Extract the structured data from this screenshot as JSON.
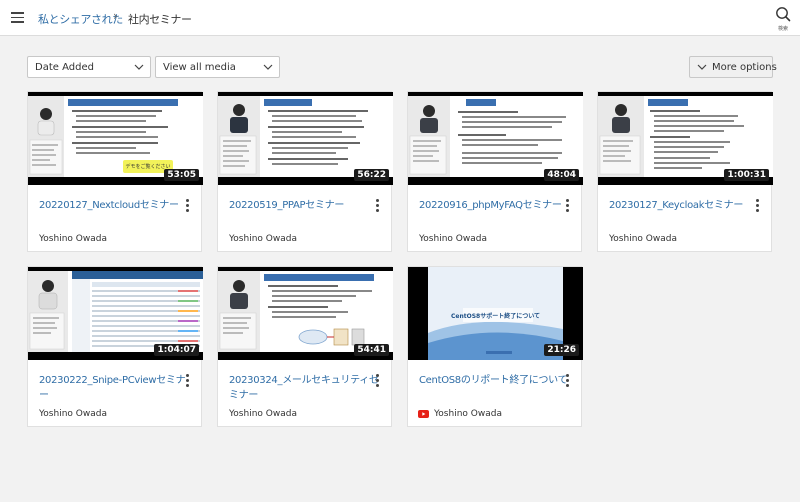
{
  "header": {
    "breadcrumb_parent": "私とシェアされた",
    "breadcrumb_separator": "›",
    "breadcrumb_current": "社内セミナー",
    "search_label": "検索"
  },
  "toolbar": {
    "sort_select": "Date Added",
    "filter_select": "View all media",
    "more_options": "More options"
  },
  "icons": {
    "menu": "hamburger-icon",
    "search": "search-icon",
    "chevron": "chevron-down-icon",
    "more": "kebab-menu-icon",
    "source": "youtube-icon"
  },
  "colors": {
    "link": "#2f6da6",
    "youtube": "#e62117"
  },
  "videos": [
    {
      "title": "20220127_Nextcloudセミナー",
      "duration": "53:05",
      "owner": "Yoshino Owada",
      "thumb_highlight": "デモをご覧ください"
    },
    {
      "title": "20220519_PPAPセミナー",
      "duration": "56:22",
      "owner": "Yoshino Owada"
    },
    {
      "title": "20220916_phpMyFAQセミナー",
      "duration": "48:04",
      "owner": "Yoshino Owada"
    },
    {
      "title": "20230127_Keycloakセミナー",
      "duration": "1:00:31",
      "owner": "Yoshino Owada"
    },
    {
      "title": "20230222_Snipe-PCviewセミナー",
      "duration": "1:04:07",
      "owner": "Yoshino Owada"
    },
    {
      "title": "20230324_メールセキュリティセミナー",
      "duration": "54:41",
      "owner": "Yoshino Owada"
    },
    {
      "title": "CentOS8のリポート終了について",
      "duration": "21:26",
      "owner": "Yoshino Owada",
      "thumb_highlight": "CentOS8サポート終了について"
    }
  ]
}
